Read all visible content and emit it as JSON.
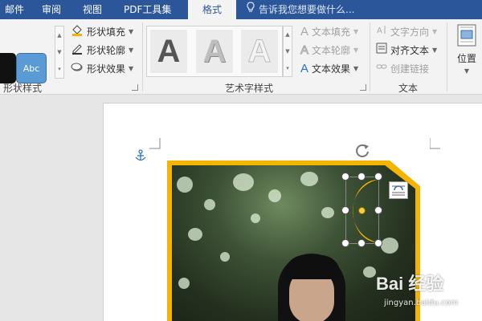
{
  "tabs": [
    "邮件",
    "审阅",
    "视图",
    "PDF工具集",
    "格式"
  ],
  "tell_me": "告诉我您想要做什么...",
  "shape_styles": {
    "sample_label": "Abc",
    "fill": "形状填充",
    "outline": "形状轮廓",
    "effects": "形状效果",
    "group_label": "形状样式"
  },
  "wordart_styles": {
    "sample_glyph": "A",
    "text_fill": "文本填充",
    "text_outline": "文本轮廓",
    "text_effects": "文本效果",
    "group_label": "艺术字样式"
  },
  "text_group": {
    "direction": "文字方向",
    "align": "对齐文本",
    "link": "创建链接",
    "group_label": "文本"
  },
  "arrange": {
    "position": "位置"
  },
  "watermark": {
    "brand": "Bai 经验",
    "url": "jingyan.baidu.com"
  },
  "colors": {
    "title_bar": "#2b579a",
    "frame": "#f4b400",
    "moon": "#f4b400"
  }
}
